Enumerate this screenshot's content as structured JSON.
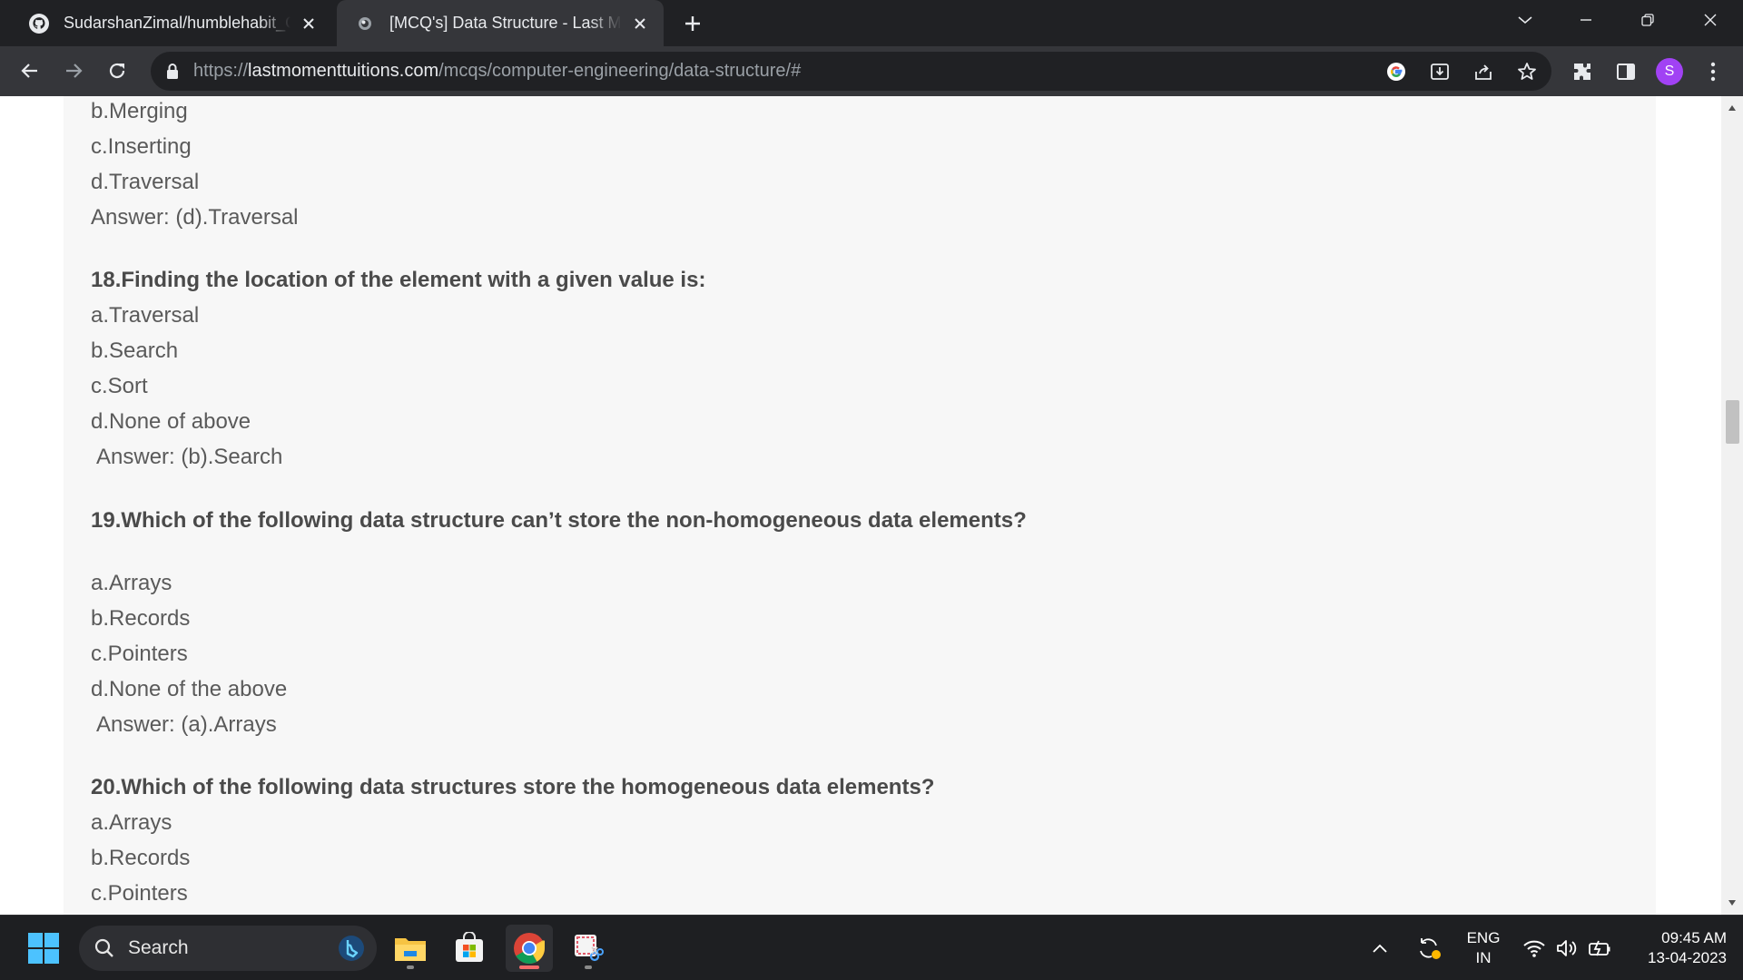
{
  "browser": {
    "tabs": [
      {
        "title": "SudarshanZimal/humblehabit_C",
        "active": false,
        "favicon": "github-icon"
      },
      {
        "title": "[MCQ's] Data Structure - Last Mo",
        "active": true,
        "favicon": "site-icon"
      }
    ],
    "url": {
      "scheme": "https://",
      "host": "lastmomenttuitions.com",
      "path": "/mcqs/computer-engineering/data-structure/#"
    },
    "profile_initial": "S",
    "profile_color": "#a142f4"
  },
  "page": {
    "background": "#f7f7f7",
    "lines": [
      {
        "text": "b.Merging",
        "kind": "option"
      },
      {
        "text": "c.Inserting",
        "kind": "option"
      },
      {
        "text": "d.Traversal",
        "kind": "option"
      },
      {
        "text": "Answer: (d).Traversal",
        "kind": "answer"
      },
      {
        "text": "18.Finding the location of the element with a given value is:",
        "kind": "question"
      },
      {
        "text": "a.Traversal",
        "kind": "option"
      },
      {
        "text": "b.Search",
        "kind": "option"
      },
      {
        "text": "c.Sort",
        "kind": "option"
      },
      {
        "text": "d.None of above",
        "kind": "option"
      },
      {
        "text": "Answer: (b).Search",
        "kind": "answer"
      },
      {
        "text": "19.Which of the following data structure can’t store the non-homogeneous data elements?",
        "kind": "question"
      },
      {
        "text": "a.Arrays",
        "kind": "option"
      },
      {
        "text": "b.Records",
        "kind": "option"
      },
      {
        "text": "c.Pointers",
        "kind": "option"
      },
      {
        "text": "d.None of the above",
        "kind": "option"
      },
      {
        "text": "Answer: (a).Arrays",
        "kind": "answer"
      },
      {
        "text": "20.Which of the following data structures store the homogeneous data elements?",
        "kind": "question"
      },
      {
        "text": "a.Arrays",
        "kind": "option"
      },
      {
        "text": "b.Records",
        "kind": "option"
      },
      {
        "text": "c.Pointers",
        "kind": "option"
      }
    ]
  },
  "taskbar": {
    "search_label": "Search",
    "language": {
      "line1": "ENG",
      "line2": "IN"
    },
    "time": "09:45 AM",
    "date": "13-04-2023"
  }
}
